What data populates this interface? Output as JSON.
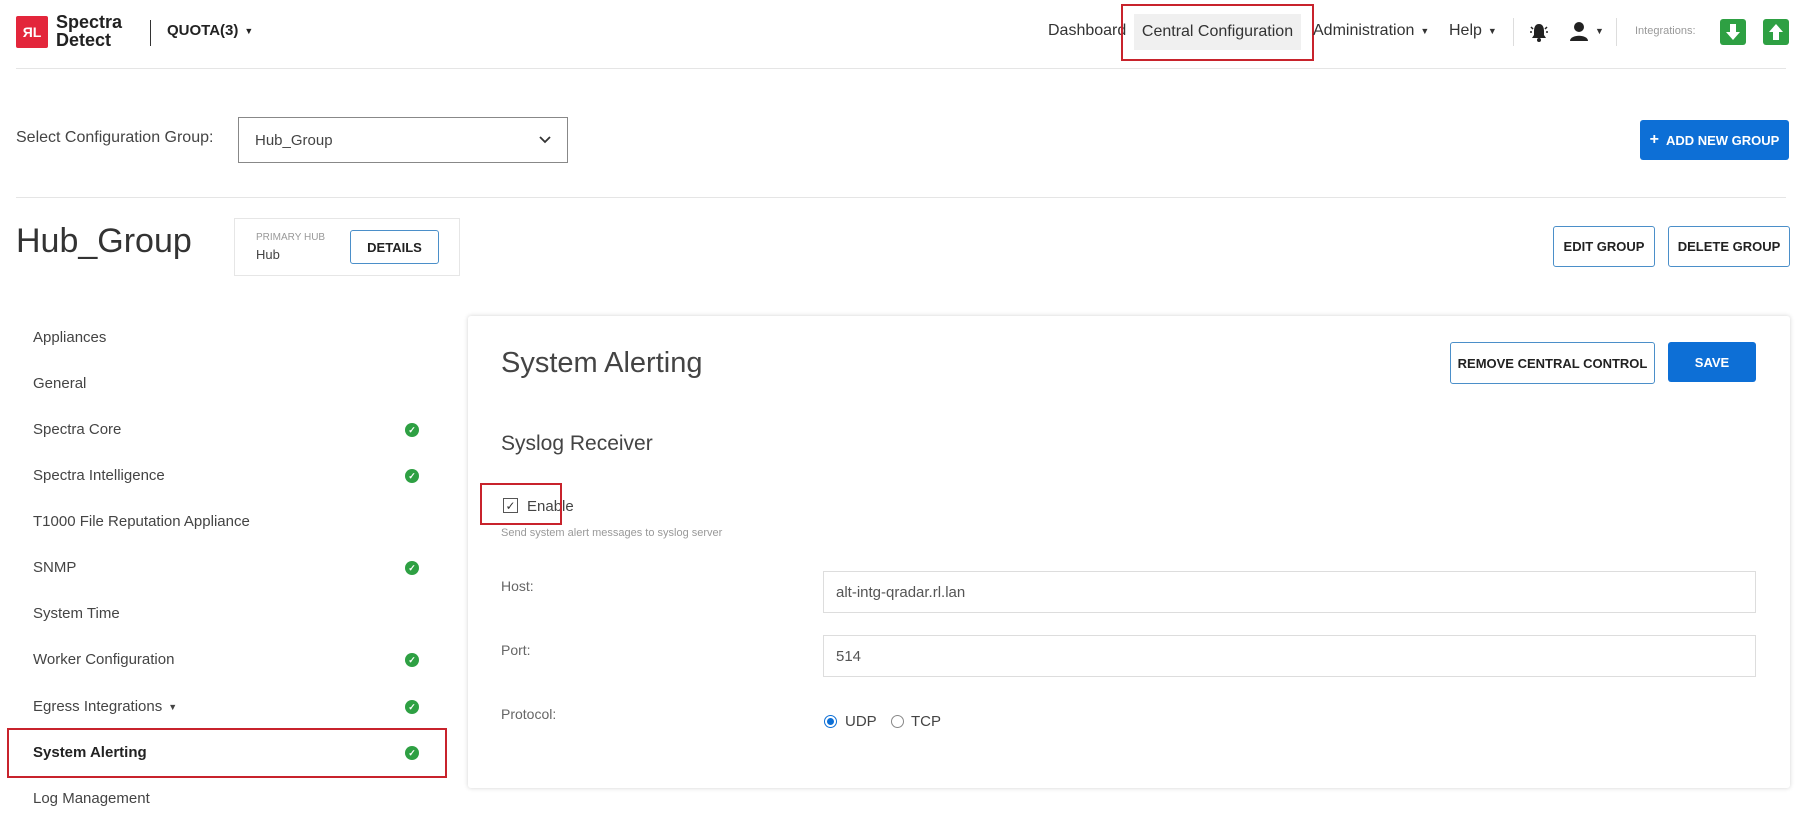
{
  "brand": {
    "logo_mark": "ЯL",
    "name_line1": "Spectra",
    "name_line2": "Detect"
  },
  "quota": {
    "label": "QUOTA(3)"
  },
  "nav": {
    "dashboard": "Dashboard",
    "central_configuration": "Central Configuration",
    "administration": "Administration",
    "help": "Help",
    "integrations_label": "Integrations:"
  },
  "config_group": {
    "label": "Select Configuration Group:",
    "selected": "Hub_Group",
    "add_button": "ADD NEW GROUP"
  },
  "group": {
    "title": "Hub_Group",
    "primary_hub_label": "PRIMARY HUB",
    "primary_hub_value": "Hub",
    "details_button": "DETAILS",
    "edit_button": "EDIT GROUP",
    "delete_button": "DELETE GROUP"
  },
  "sidebar": {
    "items": [
      {
        "label": "Appliances",
        "checked": false
      },
      {
        "label": "General",
        "checked": false
      },
      {
        "label": "Spectra Core",
        "checked": true
      },
      {
        "label": "Spectra Intelligence",
        "checked": true
      },
      {
        "label": "T1000 File Reputation Appliance",
        "checked": false
      },
      {
        "label": "SNMP",
        "checked": true
      },
      {
        "label": "System Time",
        "checked": false
      },
      {
        "label": "Worker Configuration",
        "checked": true
      },
      {
        "label": "Egress Integrations",
        "checked": true,
        "has_caret": true
      },
      {
        "label": "System Alerting",
        "checked": true,
        "active": true
      },
      {
        "label": "Log Management",
        "checked": false
      }
    ]
  },
  "panel": {
    "title": "System Alerting",
    "remove_button": "REMOVE CENTRAL CONTROL",
    "save_button": "SAVE",
    "section_title": "Syslog Receiver",
    "enable_label": "Enable",
    "enable_checked": true,
    "enable_help": "Send system alert messages to syslog server",
    "host_label": "Host:",
    "host_value": "alt-intg-qradar.rl.lan",
    "port_label": "Port:",
    "port_value": "514",
    "protocol_label": "Protocol:",
    "protocol_options": [
      "UDP",
      "TCP"
    ],
    "protocol_selected": "UDP"
  },
  "colors": {
    "brand_red": "#e3263b",
    "accent_blue": "#0d6fd6",
    "status_green": "#2ea043",
    "highlight_red": "#c8232c"
  }
}
